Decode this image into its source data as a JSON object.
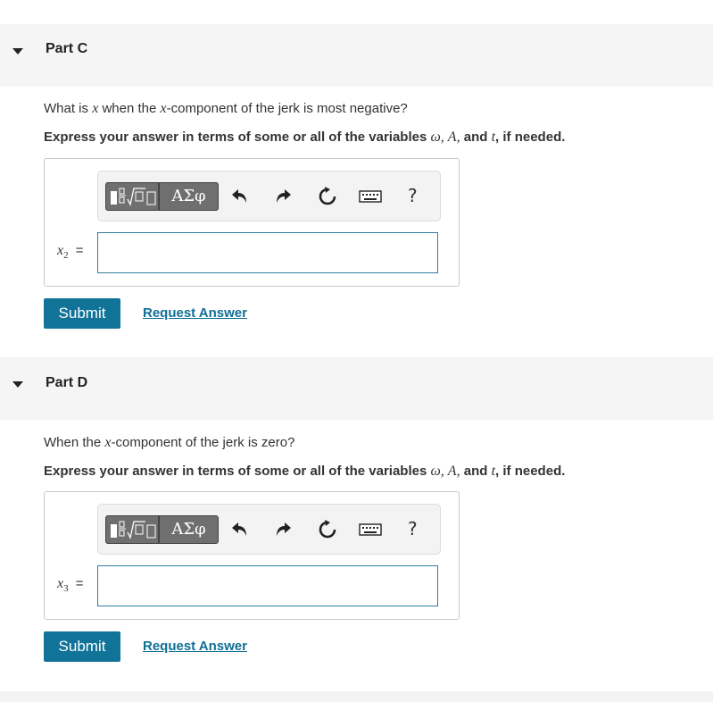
{
  "parts": [
    {
      "title": "Part C",
      "question_pre": "What is ",
      "question_var1": "x",
      "question_mid": " when the ",
      "question_var2": "x",
      "question_post": "-component of the jerk is most negative?",
      "instruction_pre": "Express your answer in terms of some or all of the variables ",
      "instruction_vars": "ω, A,",
      "instruction_and": " and ",
      "instruction_t": "t",
      "instruction_post": ", if needed.",
      "variable": "x",
      "variable_sub": "2",
      "equals": "=",
      "answer_value": "",
      "submit_label": "Submit",
      "request_label": "Request Answer"
    },
    {
      "title": "Part D",
      "question_pre": "When the ",
      "question_var1": "x",
      "question_mid": "",
      "question_var2": "",
      "question_post": "-component of the jerk is zero?",
      "instruction_pre": "Express your answer in terms of some or all of the variables ",
      "instruction_vars": "ω, A,",
      "instruction_and": " and ",
      "instruction_t": "t",
      "instruction_post": ", if needed.",
      "variable": "x",
      "variable_sub": "3",
      "equals": "=",
      "answer_value": "",
      "submit_label": "Submit",
      "request_label": "Request Answer"
    }
  ],
  "toolbar": {
    "templates_icon": "templates-icon",
    "greek_label": "ΑΣφ",
    "undo_icon": "undo-icon",
    "redo_icon": "redo-icon",
    "reset_icon": "reset-icon",
    "keyboard_icon": "keyboard-icon",
    "help_label": "?"
  },
  "colors": {
    "accent": "#127399",
    "link": "#0f6f95",
    "header_bg": "#f5f5f5"
  }
}
